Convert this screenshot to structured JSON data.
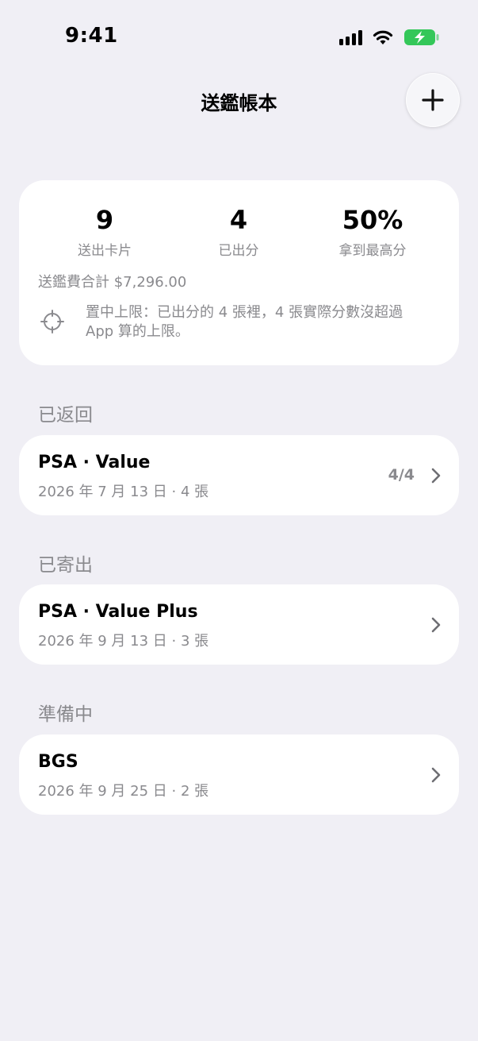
{
  "status_bar": {
    "time": "9:41"
  },
  "header": {
    "title": "送鑑帳本",
    "add_icon": "plus-icon"
  },
  "summary": {
    "stats": [
      {
        "value": "9",
        "label": "送出卡片"
      },
      {
        "value": "4",
        "label": "已出分"
      },
      {
        "value": "50%",
        "label": "拿到最高分"
      }
    ],
    "fee_total": "送鑑費合計 $7,296.00",
    "note_icon": "crosshair-icon",
    "note": "置中上限：已出分的 4 張裡，4 張實際分數沒超過 App 算的上限。"
  },
  "sections": [
    {
      "header": "已返回",
      "rows": [
        {
          "title": "PSA · Value",
          "subtitle": "2026 年 7 月 13 日 · 4 張",
          "count": "4/4"
        }
      ]
    },
    {
      "header": "已寄出",
      "rows": [
        {
          "title": "PSA · Value Plus",
          "subtitle": "2026 年 9 月 13 日 · 3 張"
        }
      ]
    },
    {
      "header": "準備中",
      "rows": [
        {
          "title": "BGS",
          "subtitle": "2026 年 9 月 25 日 · 2 張"
        }
      ]
    }
  ],
  "colors": {
    "background": "#F0EFF5",
    "secondary_text": "#8A8A8E",
    "battery": "#34C759"
  }
}
